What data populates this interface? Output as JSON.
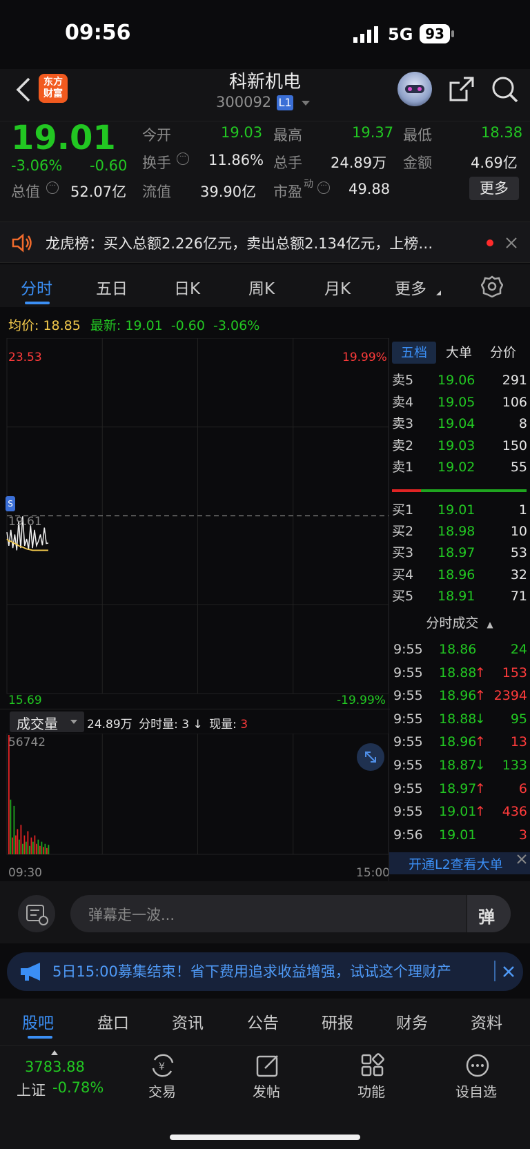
{
  "status": {
    "time": "09:56",
    "network": "5G",
    "battery": "93"
  },
  "header": {
    "title": "科新机电",
    "code": "300092",
    "level": "L1"
  },
  "quote": {
    "price": "19.01",
    "change_pct": "-3.06%",
    "change": "-0.60",
    "rows": [
      [
        {
          "label": "今开",
          "value": "19.03"
        },
        {
          "label": "最高",
          "value": "19.37"
        },
        {
          "label": "最低",
          "value": "18.38"
        }
      ],
      [
        {
          "label": "换手",
          "value": "11.86%"
        },
        {
          "label": "总手",
          "value": "24.89万"
        },
        {
          "label": "金额",
          "value": "4.69亿"
        }
      ]
    ],
    "total_value_label": "总值",
    "total_value": "52.07亿",
    "float_value_label": "流值",
    "float_value": "39.90亿",
    "pe_label": "市盈",
    "pe_sup": "动",
    "pe_value": "49.88",
    "more_button": "更多"
  },
  "notice": {
    "text": "龙虎榜：买入总额2.226亿元，卖出总额2.134亿元，上榜…"
  },
  "tabs": [
    "分时",
    "五日",
    "日K",
    "周K",
    "月K",
    "更多"
  ],
  "chart_info": {
    "avg_label": "均价:",
    "avg_value": "18.85",
    "latest_label": "最新:",
    "latest_value": "19.01",
    "latest_change": "-0.60",
    "latest_pct": "-3.06%"
  },
  "chart_data": {
    "type": "line",
    "title": "",
    "y_max": "23.53",
    "y_min": "15.69",
    "pct_max": "19.99%",
    "pct_min": "-19.99%",
    "prev_close": "19.61",
    "ylim": [
      15.69,
      23.53
    ],
    "x_start": "09:30",
    "x_end": "15:00",
    "price_series": [
      19.25,
      18.95,
      19.3,
      18.9,
      19.2,
      18.85,
      19.5,
      18.9,
      19.6,
      18.95,
      19.1,
      18.88,
      19.4,
      18.9,
      19.3,
      18.95,
      19.05,
      19.2,
      18.96,
      19.35,
      19.0,
      19.01
    ],
    "avg_series": [
      19.1,
      19.05,
      19.05,
      19.02,
      19.0,
      18.98,
      18.95,
      18.93,
      18.92,
      18.9,
      18.88,
      18.87,
      18.86,
      18.85,
      18.85,
      18.85,
      18.85,
      18.85,
      18.85,
      18.85,
      18.85,
      18.85
    ],
    "volume_max": "56742",
    "volume_series": [
      56742,
      26000,
      8000,
      23000,
      9000,
      12000,
      7000,
      14000,
      5000,
      9000,
      6000,
      11000,
      4000,
      8000,
      6000,
      9000,
      5000,
      7000,
      4000,
      6000,
      3500,
      5000,
      3000,
      4500
    ],
    "volume_colors": [
      "r",
      "g",
      "r",
      "g",
      "r",
      "r",
      "g",
      "r",
      "g",
      "r",
      "g",
      "r",
      "g",
      "r",
      "g",
      "r",
      "r",
      "g",
      "r",
      "g",
      "r",
      "g",
      "r",
      "g"
    ]
  },
  "volume_bar": {
    "selector": "成交量",
    "total": "24.89万",
    "minute_label": "分时量:",
    "minute_value": "3",
    "arrow": "↓",
    "current_label": "现量:",
    "current_value": "3"
  },
  "orderbook": {
    "tabs": [
      "五档",
      "大单",
      "分价"
    ],
    "asks": [
      {
        "label": "卖5",
        "price": "19.06",
        "vol": "291"
      },
      {
        "label": "卖4",
        "price": "19.05",
        "vol": "106"
      },
      {
        "label": "卖3",
        "price": "19.04",
        "vol": "8"
      },
      {
        "label": "卖2",
        "price": "19.03",
        "vol": "150"
      },
      {
        "label": "卖1",
        "price": "19.02",
        "vol": "55"
      }
    ],
    "bids": [
      {
        "label": "买1",
        "price": "19.01",
        "vol": "1"
      },
      {
        "label": "买2",
        "price": "18.98",
        "vol": "10"
      },
      {
        "label": "买3",
        "price": "18.97",
        "vol": "53"
      },
      {
        "label": "买4",
        "price": "18.96",
        "vol": "32"
      },
      {
        "label": "买5",
        "price": "18.91",
        "vol": "71"
      }
    ],
    "trades_title": "分时成交",
    "trades": [
      {
        "time": "9:55",
        "price": "18.86",
        "arrow": "",
        "vol": "24",
        "color": "g"
      },
      {
        "time": "9:55",
        "price": "18.88",
        "arrow": "↑",
        "vol": "153",
        "color": "r"
      },
      {
        "time": "9:55",
        "price": "18.96",
        "arrow": "↑",
        "vol": "2394",
        "color": "r"
      },
      {
        "time": "9:55",
        "price": "18.88",
        "arrow": "↓",
        "vol": "95",
        "color": "g"
      },
      {
        "time": "9:55",
        "price": "18.96",
        "arrow": "↑",
        "vol": "13",
        "color": "r"
      },
      {
        "time": "9:55",
        "price": "18.87",
        "arrow": "↓",
        "vol": "133",
        "color": "g"
      },
      {
        "time": "9:55",
        "price": "18.97",
        "arrow": "↑",
        "vol": "6",
        "color": "r"
      },
      {
        "time": "9:55",
        "price": "19.01",
        "arrow": "↑",
        "vol": "436",
        "color": "r"
      },
      {
        "time": "9:56",
        "price": "19.01",
        "arrow": "",
        "vol": "3",
        "color": "r"
      }
    ],
    "l2_promo": "开通L2查看大单"
  },
  "danmu": {
    "placeholder": "弹幕走一波...",
    "send": "弹"
  },
  "banner": {
    "text": "5日15:00募集结束！省下费用追求收益增强，试试这个理财产"
  },
  "subtabs": [
    "股吧",
    "盘口",
    "资讯",
    "公告",
    "研报",
    "财务",
    "资料"
  ],
  "bottom": {
    "index_value": "3783.88",
    "index_name": "上证",
    "index_pct": "-0.78%",
    "items": [
      {
        "label": "交易",
        "icon": "yuan-exchange-icon"
      },
      {
        "label": "发帖",
        "icon": "compose-icon"
      },
      {
        "label": "功能",
        "icon": "grid-icon"
      },
      {
        "label": "设自选",
        "icon": "more-circle-icon"
      }
    ]
  },
  "colors": {
    "up": "#ff3b3b",
    "down": "#22c722",
    "accent": "#3b8ff5",
    "avg_line": "#f2c94c",
    "bg": "#0b0b0d"
  }
}
